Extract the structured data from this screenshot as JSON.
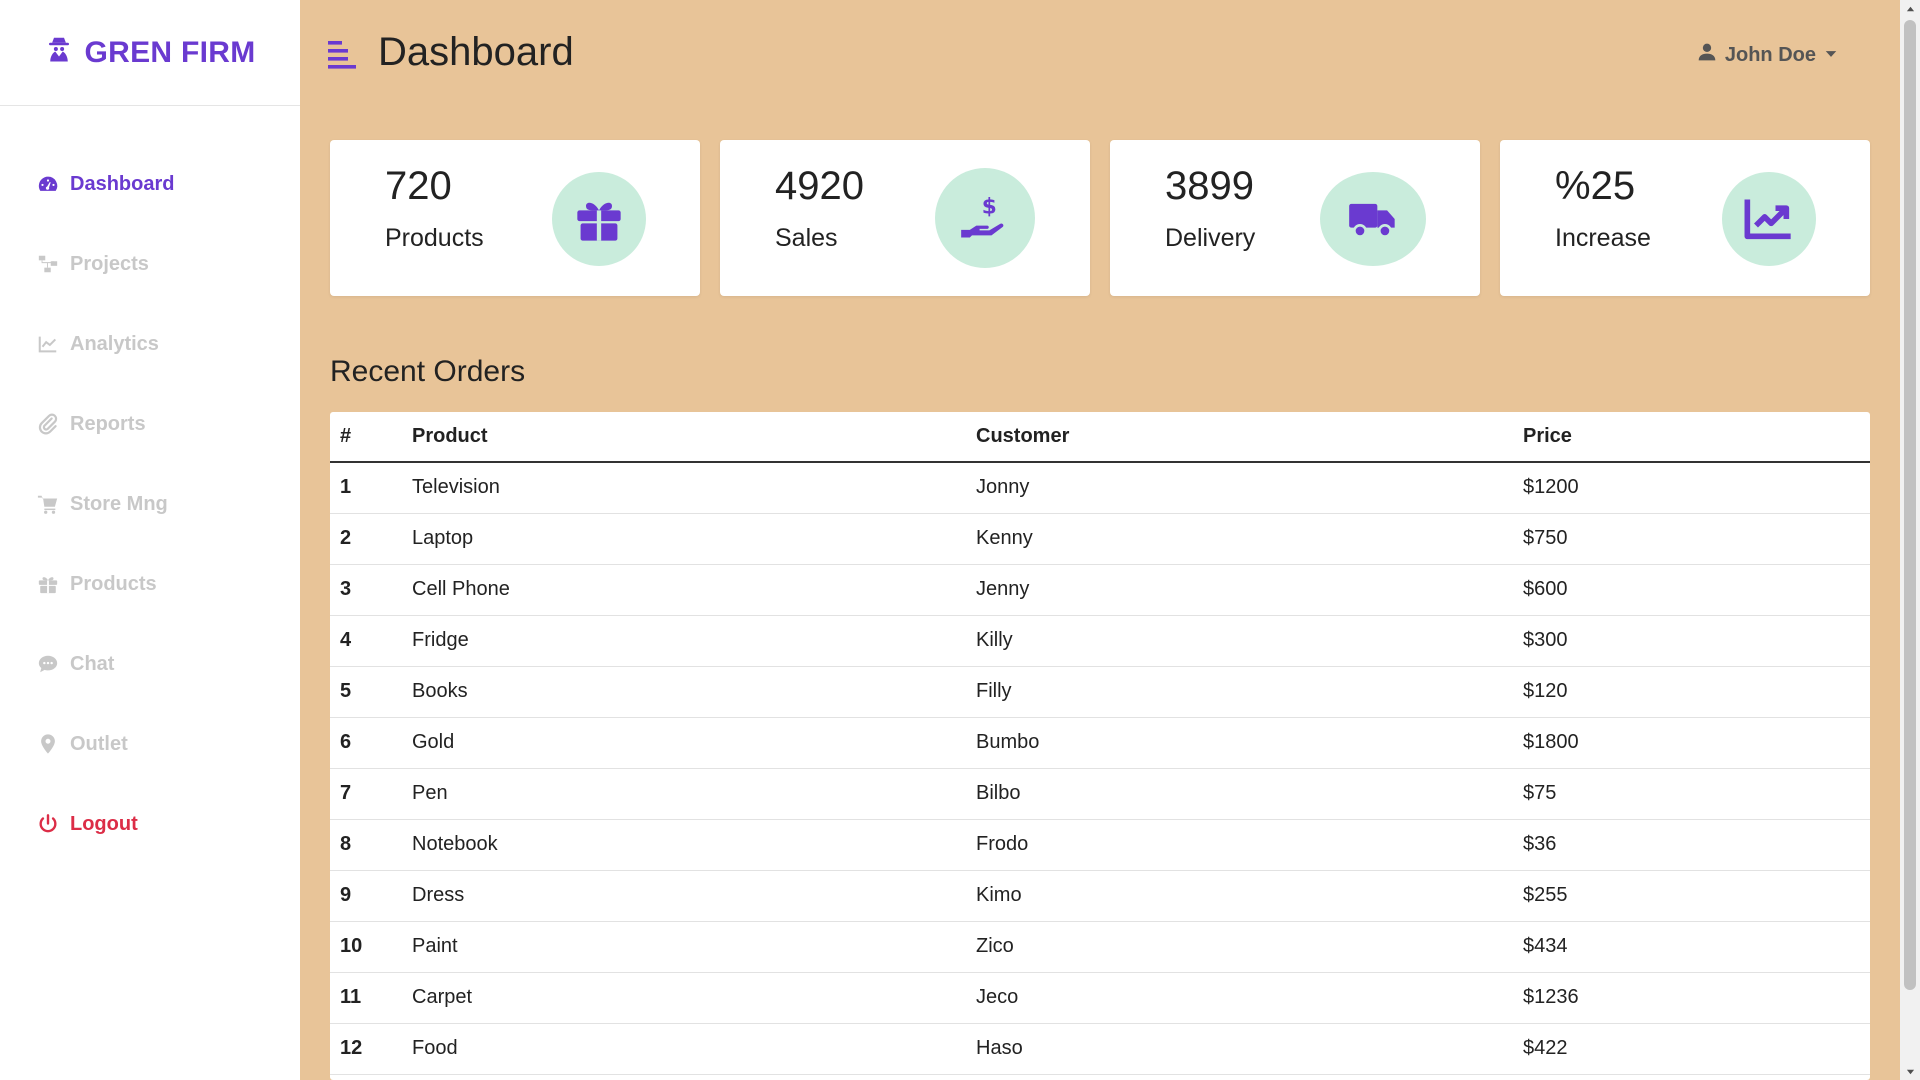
{
  "brand": {
    "name": "GREN FIRM",
    "icon": "user-secret-icon",
    "color": "#6a3ad0"
  },
  "sidebar": {
    "items": [
      {
        "label": "Dashboard",
        "icon": "tachometer-icon",
        "active": true
      },
      {
        "label": "Projects",
        "icon": "sitemap-icon"
      },
      {
        "label": "Analytics",
        "icon": "line-chart-icon"
      },
      {
        "label": "Reports",
        "icon": "paperclip-icon"
      },
      {
        "label": "Store Mng",
        "icon": "cart-icon"
      },
      {
        "label": "Products",
        "icon": "gift-icon"
      },
      {
        "label": "Chat",
        "icon": "comment-icon"
      },
      {
        "label": "Outlet",
        "icon": "map-marker-icon"
      },
      {
        "label": "Logout",
        "icon": "power-icon",
        "color": "#dc2d47"
      }
    ]
  },
  "header": {
    "title": "Dashboard",
    "user": "John Doe"
  },
  "cards": [
    {
      "value": "720",
      "label": "Products",
      "icon": "gift-icon"
    },
    {
      "value": "4920",
      "label": "Sales",
      "icon": "hand-dollar-icon"
    },
    {
      "value": "3899",
      "label": "Delivery",
      "icon": "truck-icon"
    },
    {
      "value": "%25",
      "label": "Increase",
      "icon": "chart-up-icon"
    }
  ],
  "orders": {
    "title": "Recent Orders",
    "columns": [
      "#",
      "Product",
      "Customer",
      "Price"
    ],
    "rows": [
      [
        "1",
        "Television",
        "Jonny",
        "$1200"
      ],
      [
        "2",
        "Laptop",
        "Kenny",
        "$750"
      ],
      [
        "3",
        "Cell Phone",
        "Jenny",
        "$600"
      ],
      [
        "4",
        "Fridge",
        "Killy",
        "$300"
      ],
      [
        "5",
        "Books",
        "Filly",
        "$120"
      ],
      [
        "6",
        "Gold",
        "Bumbo",
        "$1800"
      ],
      [
        "7",
        "Pen",
        "Bilbo",
        "$75"
      ],
      [
        "8",
        "Notebook",
        "Frodo",
        "$36"
      ],
      [
        "9",
        "Dress",
        "Kimo",
        "$255"
      ],
      [
        "10",
        "Paint",
        "Zico",
        "$434"
      ],
      [
        "11",
        "Carpet",
        "Jeco",
        "$1236"
      ],
      [
        "12",
        "Food",
        "Haso",
        "$422"
      ]
    ]
  },
  "colors": {
    "accent": "#6a3ad0",
    "background": "#e8c498",
    "icon_circle": "#c9ecdc",
    "logout": "#dc2d47"
  }
}
